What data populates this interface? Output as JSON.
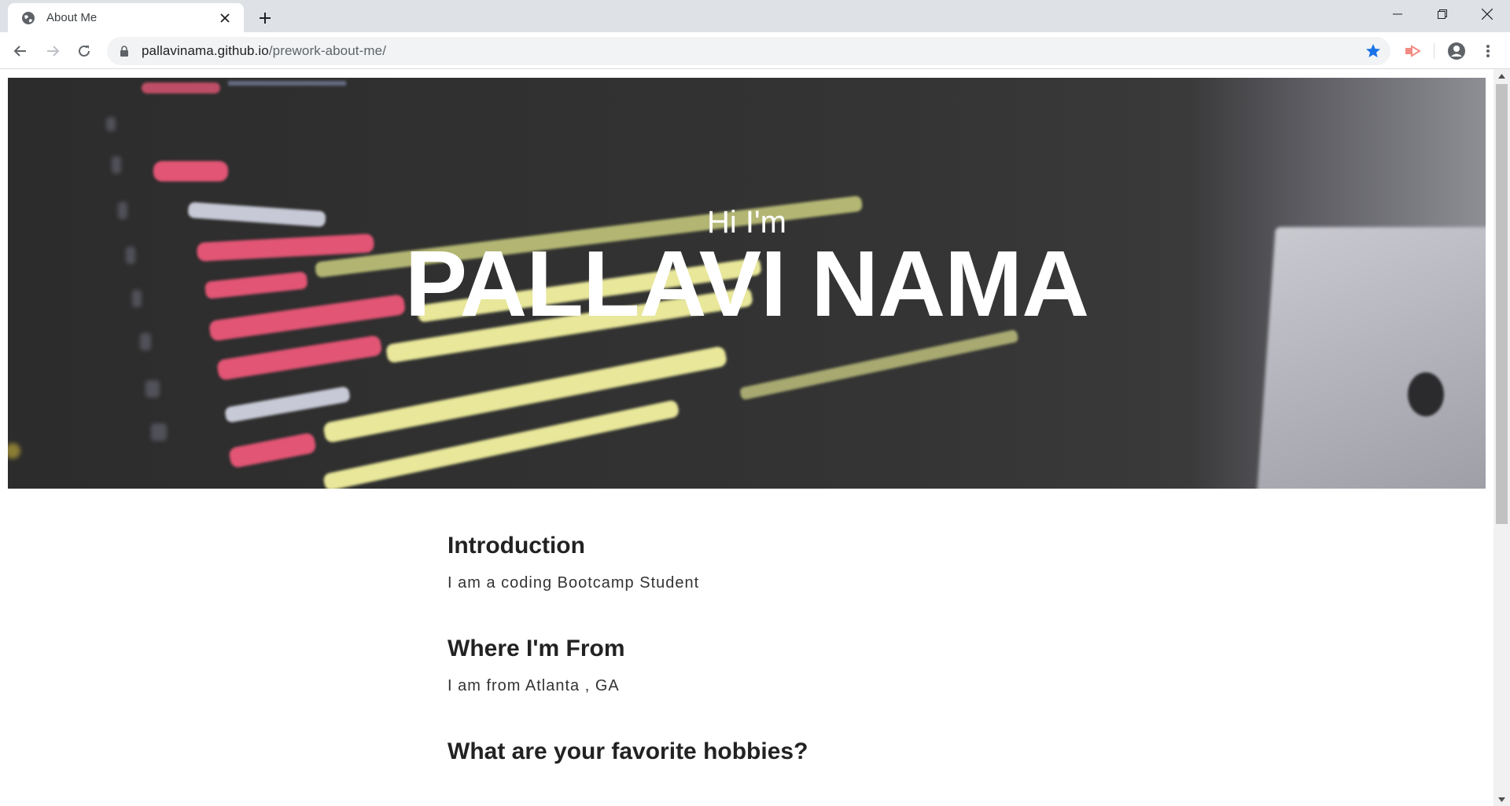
{
  "browser": {
    "tab": {
      "title": "About Me"
    },
    "address": {
      "host": "pallavinama.github.io",
      "path": "/prework-about-me/"
    }
  },
  "icons": {
    "favicon": "globe-icon",
    "tab_close": "close-icon",
    "new_tab": "plus-icon",
    "minimize": "minimize-icon",
    "restore": "restore-icon",
    "close_window": "close-icon",
    "back": "arrow-left-icon",
    "forward": "arrow-right-icon",
    "reload": "reload-icon",
    "lock": "lock-icon",
    "bookmark": "star-icon",
    "extension": "extension-icon",
    "profile": "account-icon",
    "menu": "more-vert-icon"
  },
  "colors": {
    "bookmark_star": "#1a73e8",
    "extension": "#f28b82",
    "hero_text": "#ffffff",
    "heading_text": "#222222"
  },
  "hero": {
    "greeting": "Hi I'm",
    "name": "PALLAVI NAMA"
  },
  "sections": [
    {
      "heading": "Introduction",
      "text": "I am a coding Bootcamp Student"
    },
    {
      "heading": "Where I'm From",
      "text": "I am from Atlanta , GA"
    },
    {
      "heading": "What are your favorite hobbies?"
    }
  ]
}
